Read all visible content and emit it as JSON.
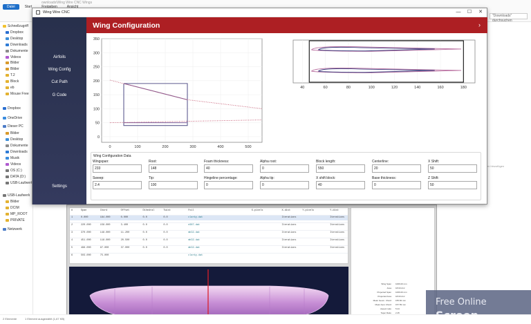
{
  "background": {
    "explorer": {
      "title_fragment": "ownloads\\Wing Wire CNC Wings",
      "tabs": [
        "Datei",
        "Start",
        "Freigeben",
        "Ansicht"
      ],
      "search_placeholder": "\"Downloads\" durchsuchen",
      "sidebar": [
        "Schnellzugriff",
        "Dropbox",
        "Desktop",
        "Downloads",
        "Dokumente",
        "Videos",
        "Bilder",
        "Bilder",
        "T.2",
        "Block",
        "eb",
        "Mouse Free",
        "Dropbox",
        "OneDrive",
        "Dieser PC",
        "Bilder",
        "Desktop",
        "Dokumente",
        "Downloads",
        "Musik",
        "Videos",
        "OS (C:)",
        "DATA (D:)",
        "USB-Laufwerk",
        "USB-Laufwerk",
        "Bilder",
        "DCIM",
        "MP_ROOT",
        "PRIVATE",
        "Netzwerk"
      ],
      "right_text": "en hinzufügen",
      "status_left": "2 Elemente",
      "status_mid": "1 Element ausgewählt (1,67 KB)"
    },
    "lower_table": {
      "headers": [
        "#",
        "Span",
        "Chord",
        "Offset",
        "Dihedral",
        "Twist",
        "Foil",
        "X-pixels",
        "X-dist",
        "Y-pixels",
        "Y-dist"
      ],
      "rows": [
        [
          "1",
          "0.000",
          "184.000",
          "0.000",
          "0.0",
          "0.0",
          "clarky.dat",
          "",
          "Iterations",
          "",
          "Iterations"
        ],
        [
          "2",
          "220.000",
          "158.000",
          "3.400",
          "0.0",
          "0.0",
          "e387.dat",
          "",
          "Iterations",
          "",
          "Iterations"
        ],
        [
          "3",
          "370.000",
          "148.000",
          "11.200",
          "0.0",
          "0.0",
          "mh32.dat",
          "",
          "Iterations",
          "",
          "Iterations"
        ],
        [
          "4",
          "451.000",
          "118.000",
          "20.500",
          "0.0",
          "0.0",
          "mh32.dat",
          "",
          "Iterations",
          "",
          "Iterations"
        ],
        [
          "5",
          "496.000",
          "97.000",
          "37.000",
          "0.0",
          "0.0",
          "mh32.dat",
          "",
          "Iterations",
          "",
          "Iterations"
        ],
        [
          "6",
          "503.000",
          "75.000",
          "",
          "",
          "",
          "clarky.dat",
          "",
          "",
          "",
          ""
        ]
      ],
      "props": [
        [
          "Wing Span",
          "1006.00 mm"
        ],
        [
          "Area",
          "18.60 dm²"
        ],
        [
          "Projected Span",
          "1006.00 mm"
        ],
        [
          "Projected Area",
          "18.60 dm²"
        ],
        [
          "Mean Geom. Chord",
          "155.84 mm"
        ],
        [
          "Mean Aero Chord",
          "157.59 mm"
        ],
        [
          "Aspect ratio",
          "5.44"
        ],
        [
          "Taper Ratio",
          "2.45"
        ],
        [
          "Root to Tip Sweep",
          "21.00°"
        ]
      ]
    },
    "watermark": {
      "line1": "Free Online",
      "line2": "Screen Recorder"
    }
  },
  "window": {
    "title": "Wing Wire CNC",
    "controls": {
      "minimize": "—",
      "maximize": "☐",
      "close": "✕"
    }
  },
  "nav": {
    "items": [
      "Airfoils",
      "Wing Config",
      "Cut Path",
      "G Code"
    ],
    "settings": "Settings"
  },
  "header": {
    "title": "Wing Configuration",
    "chevron": "›"
  },
  "chart_data": [
    {
      "type": "line",
      "name": "planform-chart",
      "xticks": [
        0,
        100,
        200,
        300,
        400,
        500
      ],
      "yticks": [
        0,
        50,
        100,
        150,
        200,
        250,
        300,
        350
      ],
      "xlim": [
        -30,
        550
      ],
      "ylim": [
        -20,
        350
      ],
      "grid": true,
      "series": [
        {
          "name": "block outline",
          "color": "#5e5b8f",
          "style": "solid",
          "points": [
            [
              50,
              190
            ],
            [
              280,
              190
            ],
            [
              280,
              40
            ],
            [
              50,
              40
            ],
            [
              50,
              190
            ]
          ]
        },
        {
          "name": "leading edge",
          "color": "#7c5e9a",
          "style": "solid",
          "points": [
            [
              50,
              190
            ],
            [
              280,
              132
            ]
          ]
        },
        {
          "name": "trailing edge",
          "color": "#7c5e9a",
          "style": "solid",
          "points": [
            [
              50,
              50
            ],
            [
              280,
              50
            ]
          ]
        },
        {
          "name": "leading edge extension",
          "color": "#c2506a",
          "style": "dotted",
          "points": [
            [
              0,
              202
            ],
            [
              280,
              132
            ],
            [
              550,
              100
            ]
          ]
        },
        {
          "name": "trailing edge extension",
          "color": "#c2506a",
          "style": "dotted",
          "points": [
            [
              0,
              50
            ],
            [
              550,
              60
            ]
          ]
        }
      ]
    },
    {
      "type": "line",
      "name": "airfoil-chart",
      "xticks": [
        40,
        60,
        80,
        100,
        120,
        140,
        160,
        180
      ],
      "xlim": [
        32,
        190
      ],
      "ylim": [
        -1,
        1
      ],
      "grid": true,
      "series": [
        {
          "name": "root airfoil",
          "color": "#b86c9e",
          "values_x": [
            48,
            55,
            80,
            110,
            140,
            170,
            178
          ]
        },
        {
          "name": "tip airfoil",
          "color": "#3c3d7e",
          "values_x": [
            54,
            60,
            80,
            100,
            120,
            140,
            155
          ]
        }
      ]
    }
  ],
  "config": {
    "group_title": "Wing Configuration Data",
    "fields": [
      {
        "key": "wingspan",
        "label": "Wingspan:",
        "value": "233"
      },
      {
        "key": "root",
        "label": "Root:",
        "value": "148"
      },
      {
        "key": "foam_thickness",
        "label": "Foam thickness:",
        "value": "40"
      },
      {
        "key": "alpha_root",
        "label": "Alpha root:",
        "value": "0"
      },
      {
        "key": "block_length",
        "label": "Block length:",
        "value": "550"
      },
      {
        "key": "centerline",
        "label": "Centerline:",
        "value": "20"
      },
      {
        "key": "x_shift",
        "label": "X Shift:",
        "value": "50"
      },
      {
        "key": "sweep",
        "label": "Sweep:",
        "value": "2.4"
      },
      {
        "key": "tip",
        "label": "Tip:",
        "value": "100"
      },
      {
        "key": "hingeline_percentage",
        "label": "Hingeline percentage:",
        "value": "0"
      },
      {
        "key": "alpha_tip",
        "label": "Alpha tip:",
        "value": "0"
      },
      {
        "key": "x_shift_block",
        "label": "X shift block:",
        "value": "40"
      },
      {
        "key": "base_thickness",
        "label": "Base thickness:",
        "value": "0"
      },
      {
        "key": "z_shift",
        "label": "Z Shift:",
        "value": "50"
      }
    ]
  }
}
